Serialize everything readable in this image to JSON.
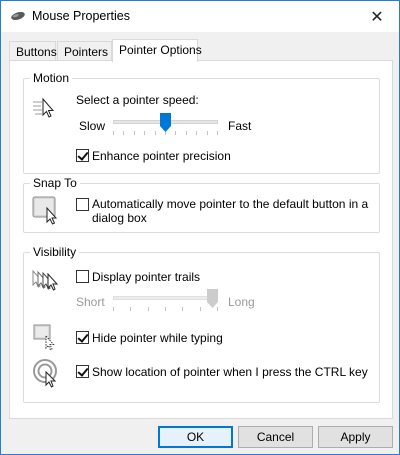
{
  "window": {
    "title": "Mouse Properties",
    "close_glyph": "✕"
  },
  "tabs": [
    {
      "label": "Buttons",
      "active": false
    },
    {
      "label": "Pointers",
      "active": false
    },
    {
      "label": "Pointer Options",
      "active": true
    }
  ],
  "motion": {
    "group_label": "Motion",
    "speed_label": "Select a pointer speed:",
    "slow_label": "Slow",
    "fast_label": "Fast",
    "speed_fraction": 0.5,
    "enhance_label": "Enhance pointer precision",
    "enhance_checked": true
  },
  "snap_to": {
    "group_label": "Snap To",
    "auto_label_line1": "Automatically move pointer to the default button in a",
    "auto_label_line2": "dialog box",
    "auto_checked": false
  },
  "visibility": {
    "group_label": "Visibility",
    "trails_label": "Display pointer trails",
    "trails_checked": false,
    "short_label": "Short",
    "long_label": "Long",
    "trails_fraction": 1.0,
    "trails_enabled": false,
    "hide_label": "Hide pointer while typing",
    "hide_checked": true,
    "ctrl_label": "Show location of pointer when I press the CTRL key",
    "ctrl_checked": true
  },
  "buttons": {
    "ok": "OK",
    "cancel": "Cancel",
    "apply": "Apply"
  },
  "colors": {
    "accent": "#0078d7",
    "window_border": "#2b7bd3",
    "slider_thumb": "#0078d7",
    "disabled_text": "#9a9a9a"
  }
}
